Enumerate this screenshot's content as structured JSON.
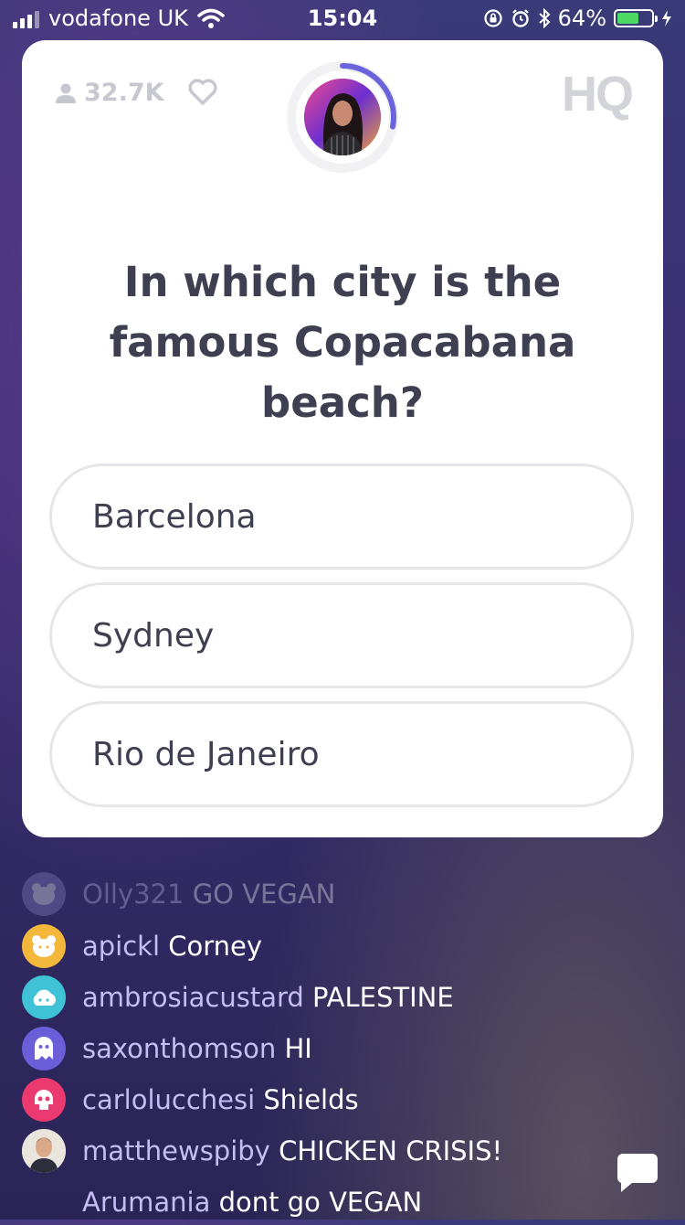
{
  "status_bar": {
    "carrier": "vodafone UK",
    "time": "15:04",
    "battery_percent": "64%",
    "battery_level": 0.64
  },
  "header": {
    "viewer_count": "32.7K",
    "logo": "HQ",
    "timer_progress": 0.28
  },
  "question": "In which city is the famous Copacabana beach?",
  "answers": [
    "Barcelona",
    "Sydney",
    "Rio de Janeiro"
  ],
  "chat": [
    {
      "user": "Olly321",
      "text": "GO VEGAN",
      "avatar_color": "#8f86c9",
      "icon": "bear-icon"
    },
    {
      "user": "apickl",
      "text": "Corney",
      "avatar_color": "#f2b73b",
      "icon": "bear-icon"
    },
    {
      "user": "ambrosiacustard",
      "text": "PALESTINE",
      "avatar_color": "#3fc1d6",
      "icon": "cloud-icon"
    },
    {
      "user": "saxonthomson",
      "text": "HI",
      "avatar_color": "#6a5fd8",
      "icon": "ghost-icon"
    },
    {
      "user": "carlolucchesi",
      "text": "Shields",
      "avatar_color": "#ea3a70",
      "icon": "skull-icon"
    },
    {
      "user": "matthewspiby",
      "text": "CHICKEN CRISIS!",
      "avatar_color": "#cfc8c0",
      "icon": "photo-avatar"
    },
    {
      "user": "Arumania",
      "text": "dont go VEGAN",
      "avatar_color": "#5a4fb0",
      "icon": "none"
    }
  ],
  "colors": {
    "accent": "#6b63dc",
    "username": "#c6bdf5",
    "card_text": "#3e3f50"
  }
}
